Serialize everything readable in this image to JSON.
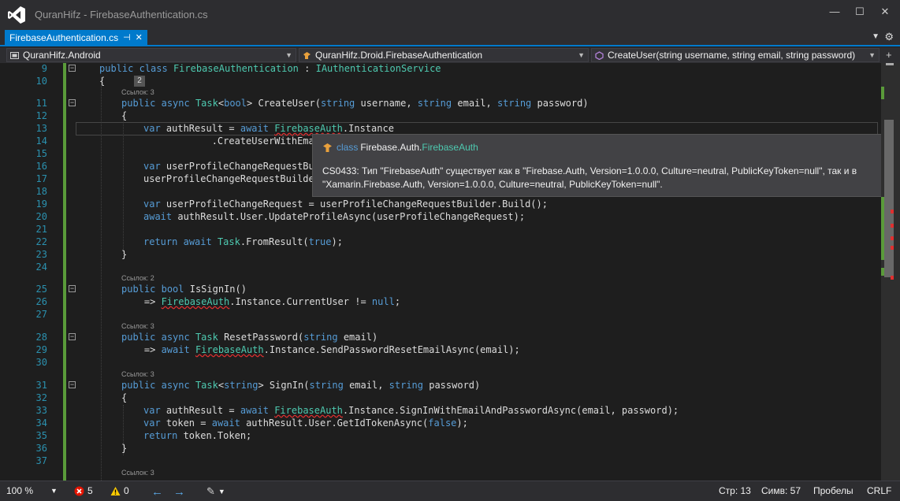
{
  "window": {
    "title": "QuranHifz - FirebaseAuthentication.cs",
    "min": "—",
    "max": "☐",
    "close": "✕"
  },
  "tab": {
    "label": "FirebaseAuthentication.cs",
    "pin": "⊣",
    "close": "✕"
  },
  "nav": {
    "project": "QuranHifz.Android",
    "class": "QuranHifz.Droid.FirebaseAuthentication",
    "member": "CreateUser(string username, string email, string password)"
  },
  "tooltip": {
    "kw": "class",
    "ns": "Firebase.Auth.",
    "type": "FirebaseAuth",
    "message": "CS0433: Тип \"FirebaseAuth\" существует как в \"Firebase.Auth, Version=1.0.0.0, Culture=neutral, PublicKeyToken=null\", так и в \"Xamarin.Firebase.Auth, Version=1.0.0.0, Culture=neutral, PublicKeyToken=null\"."
  },
  "code": {
    "n9": "9",
    "n10": "10",
    "n11": "11",
    "n12": "12",
    "n13": "13",
    "n14": "14",
    "n15": "15",
    "n16": "16",
    "n17": "17",
    "n18": "18",
    "n19": "19",
    "n20": "20",
    "n21": "21",
    "n22": "22",
    "n23": "23",
    "n24": "24",
    "n25": "25",
    "n26": "26",
    "n27": "27",
    "n28": "28",
    "n29": "29",
    "n30": "30",
    "n31": "31",
    "n32": "32",
    "n33": "33",
    "n34": "34",
    "n35": "35",
    "n36": "36",
    "n37": "37",
    "ref3": "Ссылок: 3",
    "ref2": "Ссылок: 2",
    "badge": "2",
    "k_public": "public",
    "k_class": "class",
    "k_async": "async",
    "k_bool": "bool",
    "k_string": "string",
    "k_var": "var",
    "k_await": "await",
    "k_return": "return",
    "k_true": "true",
    "k_null": "null",
    "k_false": "false",
    "t_FirebaseAuthentication": "FirebaseAuthentication",
    "t_IAuthService": "IAuthenticationService",
    "t_Task": "Task",
    "t_FirebaseAuth": "FirebaseAuth",
    "l13": " authResult = ",
    "l13b": ".Instance",
    "l14": "            .CreateUserWithEmailAnd",
    "l16": " userProfileChangeRequestBui",
    "l17": "userProfileChangeRequestBuilder",
    "l19": " userProfileChangeRequest = userProfileChangeRequestBuilder.Build();",
    "l20": " authResult.User.UpdateProfileAsync(userProfileChangeRequest);",
    "l22b": ".FromResult(",
    "l22c": ");",
    "createUser": " CreateUser(",
    "cu_user": " username, ",
    "cu_email": " email, ",
    "cu_pw": " password)",
    "isSignIn": " IsSignIn()",
    "l26a": "    => ",
    "l26b": ".Instance.CurrentUser != ",
    "l26c": ";",
    "resetPw": " ResetPassword(",
    "rp_email": " email)",
    "l29a": "    => ",
    "l29b": ".Instance.SendPasswordResetEmailAsync(email);",
    "signIn": " SignIn(",
    "si_email": " email, ",
    "si_pw": " password)",
    "l33b": ".Instance.SignInWithEmailAndPasswordAsync(email, password);",
    "l34a": " token = ",
    "l34b": " authResult.User.GetIdTokenAsync(",
    "l34c": ");",
    "l35": " token.Token;",
    "brace_open": "{",
    "brace_close": "}",
    "lt": "<",
    "gt": ">",
    "semi": ";"
  },
  "status": {
    "zoom": "100 %",
    "errors": "5",
    "warnings": "0",
    "line": "Стр: 13",
    "col": "Симв: 57",
    "spaces": "Пробелы",
    "eol": "CRLF"
  },
  "colors": {
    "accent": "#007acc",
    "keyword": "#569cd6",
    "type": "#4ec9b0",
    "error": "#e03030"
  }
}
